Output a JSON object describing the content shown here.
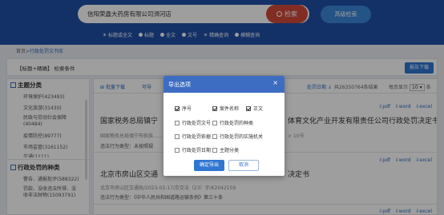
{
  "header": {
    "search_value": "信阳荣鑫大药房有限公司浉河店",
    "search_button": "检索",
    "advanced_button": "高级检索",
    "options": [
      {
        "label": "标题或全文",
        "selected": true
      },
      {
        "label": "标题",
        "selected": false
      },
      {
        "label": "全文",
        "selected": false
      },
      {
        "label": "文号",
        "selected": false
      },
      {
        "label": "精确查询",
        "selected": true
      },
      {
        "label": "模糊查询",
        "selected": false
      }
    ]
  },
  "breadcrumb": {
    "home": "首页",
    "sep": ">",
    "current": "行政处罚文书库"
  },
  "condition": {
    "label": "【标题+精确】 检索条件",
    "report_button": "报告下载"
  },
  "sidebar": {
    "section1": "主题分类",
    "items1": [
      "环境保护(423493)",
      "文化旅游(31430)",
      "民政与劳动社会保障(40484)",
      "疫情防控(89777)",
      "市场监管(3161152)",
      "交通(1111)"
    ],
    "section2": "行政处罚的种类",
    "items2": [
      "警告、通报批评(588322)",
      "罚款、没收违法所得、没收非法财物(15093791)"
    ]
  },
  "results": {
    "batch_download": "批量下载",
    "batch_export": "可导",
    "date_sort": "处罚日期",
    "total": "共26350764条结果",
    "per_page_label": "每页显示",
    "per_page_value": "10",
    "per_page_unit": "条",
    "export_pdf": "pdf",
    "export_word": "word",
    "export_excel": "excel",
    "items": [
      {
        "title": "国家税务总局镇宁……体育文化产业开发有限责任公司行政处罚决定书",
        "title_left": "国家税务总局镇宁",
        "title_right": "体育文化产业开发有限责任公司行政处罚决定书",
        "meta": "国家税务总局镇宁布依族……",
        "meta_right": "> 10号",
        "type_line": "违法行为类型：未按照规"
      },
      {
        "title_left": "北京市房山区交通",
        "title_right": "决定书",
        "meta": "北京市房山区交通局/2023-03-17/京交法（23）字/K2042159",
        "type_line": "违法行为类型：《中华人民共和国道路运输条例》第三十条"
      }
    ]
  },
  "modal": {
    "title": "导出选项",
    "close": "×",
    "checkboxes": [
      {
        "label": "序号",
        "checked": true
      },
      {
        "label": "案件名称",
        "checked": true
      },
      {
        "label": "正文",
        "checked": true
      },
      {
        "label": "行政处罚文号",
        "checked": false
      },
      {
        "label": "行政处罚的种类",
        "checked": false
      },
      {
        "label": "行政处罚依据",
        "checked": false
      },
      {
        "label": "行政处罚的实施机关",
        "checked": false
      },
      {
        "label": "行政处罚日期",
        "checked": false
      },
      {
        "label": "主题分类",
        "checked": false
      }
    ],
    "ok_button": "确定导出",
    "cancel_button": "取消"
  }
}
